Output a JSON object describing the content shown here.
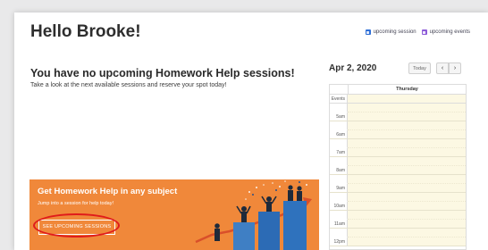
{
  "header": {
    "greeting": "Hello Brooke!"
  },
  "legend": {
    "items": [
      {
        "label": "upcoming session",
        "color": "#2f6fd6"
      },
      {
        "label": "upcoming events",
        "color": "#8d5bd8"
      }
    ]
  },
  "sessions": {
    "empty_title": "You have no upcoming Homework Help sessions!",
    "empty_subtitle": "Take a look at the next available sessions and reserve your spot today!"
  },
  "banner": {
    "title": "Get Homework Help in any subject",
    "subtitle": "Jump into a session for help today!",
    "button_label": "SEE UPCOMING SESSIONS",
    "background_color": "#f0883a",
    "annotation_color": "#e01b1b"
  },
  "calendar": {
    "date": "Apr 2, 2020",
    "today_label": "Today",
    "prev_icon": "‹",
    "next_icon": "›",
    "day_header": "Thursday",
    "events_label": "Events",
    "hours": [
      "5am",
      "6am",
      "7am",
      "8am",
      "9am",
      "10am",
      "11am",
      "12pm"
    ],
    "cell_color": "#fcf8e3"
  }
}
